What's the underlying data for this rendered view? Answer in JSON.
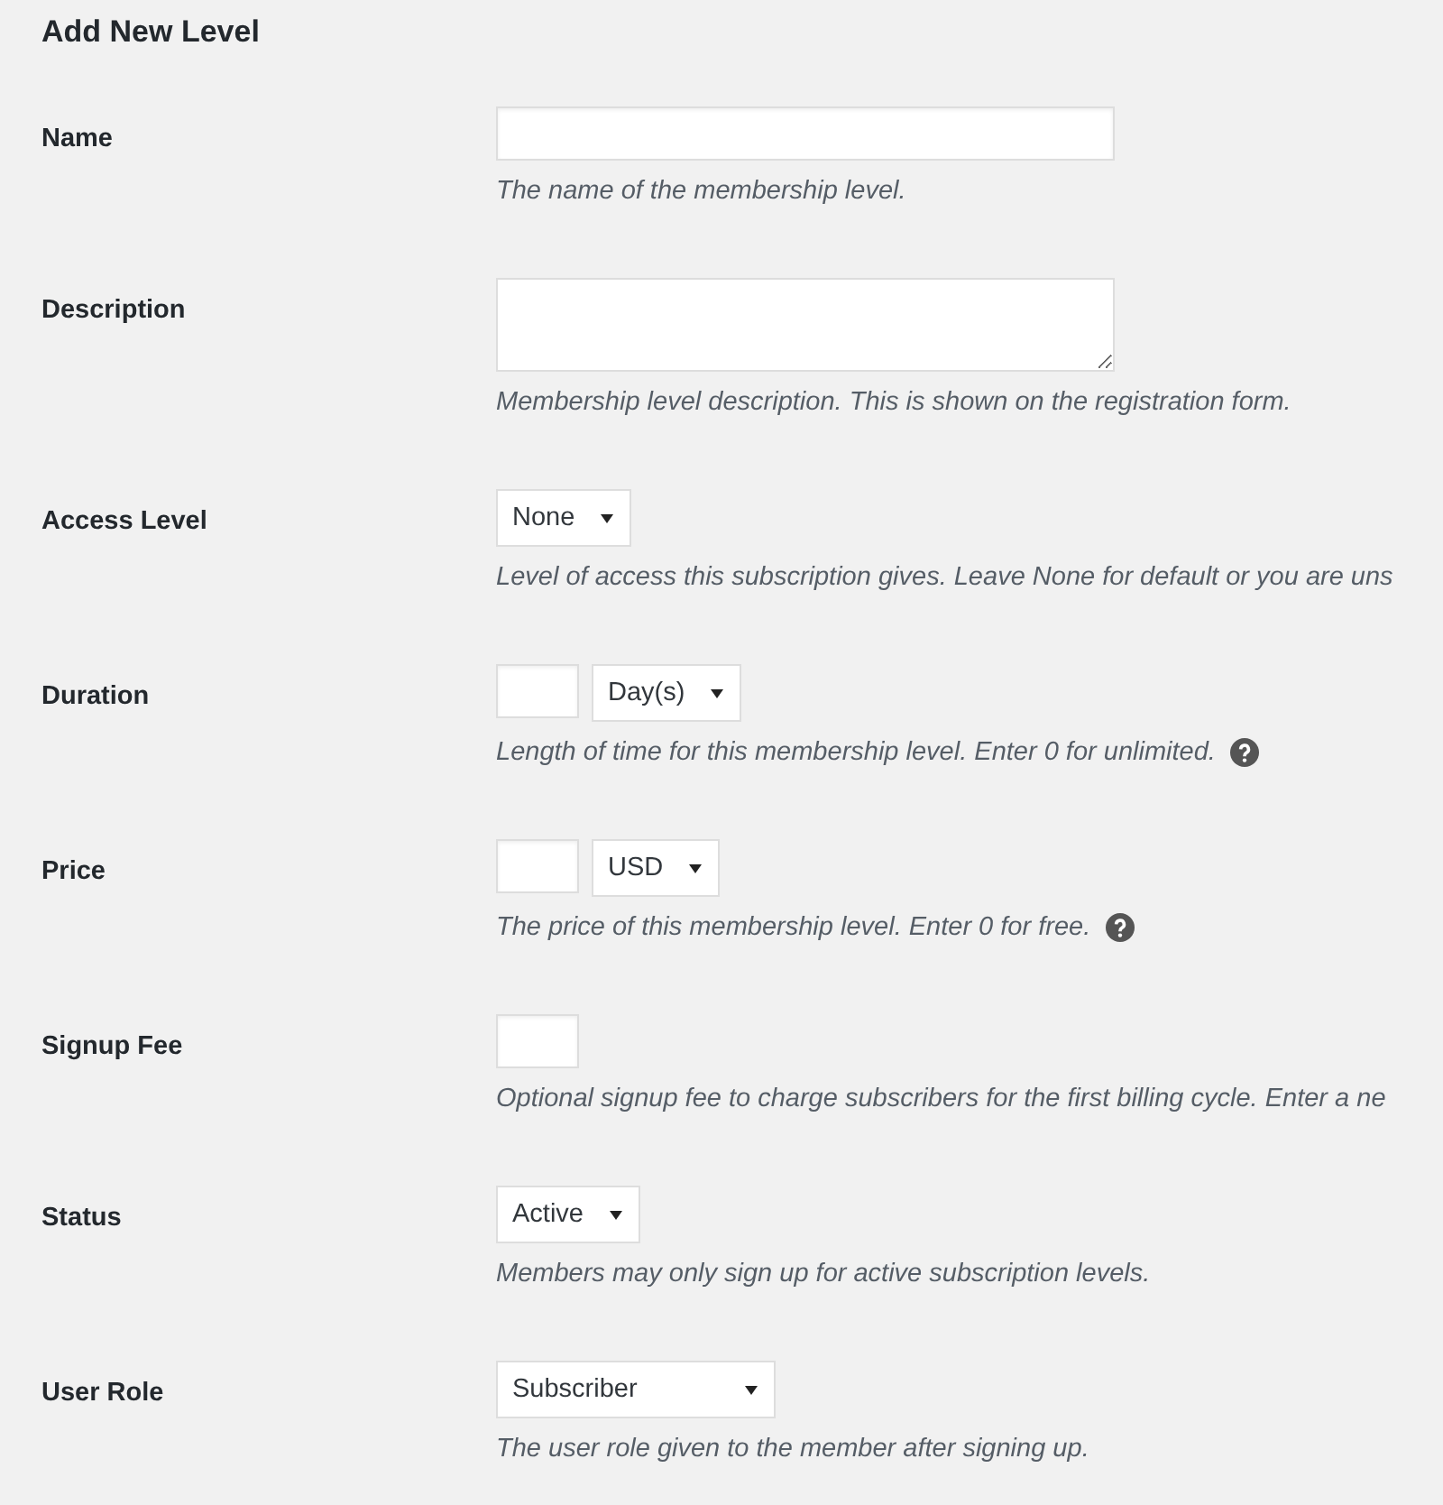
{
  "title": "Add New Level",
  "rows": [
    {
      "label": "Name",
      "controls": [
        {
          "kind": "text"
        }
      ],
      "description": "The name of the membership level.",
      "help": false
    },
    {
      "label": "Description",
      "controls": [
        {
          "kind": "textarea"
        }
      ],
      "description": "Membership level description. This is shown on the registration form.",
      "help": false
    },
    {
      "label": "Access Level",
      "controls": [
        {
          "kind": "select",
          "value": "None"
        }
      ],
      "description": "Level of access this subscription gives. Leave None for default or you are uns",
      "help": false
    },
    {
      "label": "Duration",
      "controls": [
        {
          "kind": "number"
        },
        {
          "kind": "select",
          "value": "Day(s)"
        }
      ],
      "description": "Length of time for this membership level. Enter 0 for unlimited.",
      "help": true
    },
    {
      "label": "Price",
      "controls": [
        {
          "kind": "number"
        },
        {
          "kind": "select",
          "value": "USD"
        }
      ],
      "description": "The price of this membership level. Enter 0 for free.",
      "help": true
    },
    {
      "label": "Signup Fee",
      "controls": [
        {
          "kind": "number"
        }
      ],
      "description": "Optional signup fee to charge subscribers for the first billing cycle. Enter a ne",
      "help": false
    },
    {
      "label": "Status",
      "controls": [
        {
          "kind": "select",
          "value": "Active"
        }
      ],
      "description": "Members may only sign up for active subscription levels.",
      "help": false
    },
    {
      "label": "User Role",
      "controls": [
        {
          "kind": "select",
          "value": "Subscriber",
          "wide": true
        }
      ],
      "description": "The user role given to the member after signing up.",
      "help": false
    }
  ]
}
